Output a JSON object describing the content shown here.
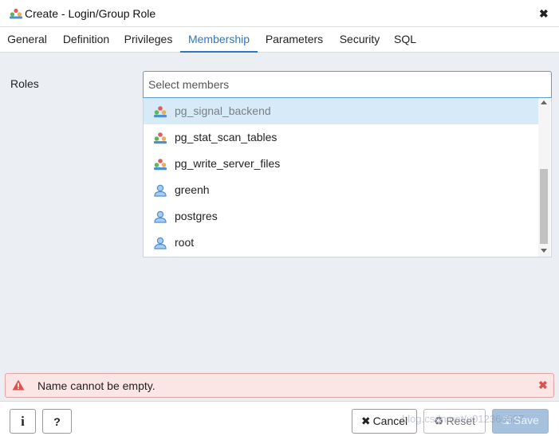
{
  "dialog": {
    "title": "Create - Login/Group Role"
  },
  "tabs": [
    {
      "label": "General"
    },
    {
      "label": "Definition"
    },
    {
      "label": "Privileges"
    },
    {
      "label": "Membership",
      "active": true
    },
    {
      "label": "Parameters"
    },
    {
      "label": "Security"
    },
    {
      "label": "SQL"
    }
  ],
  "roles": {
    "label": "Roles",
    "placeholder": "Select members",
    "options": [
      {
        "label": "pg_signal_backend",
        "icon": "group-role-icon",
        "highlighted": true
      },
      {
        "label": "pg_stat_scan_tables",
        "icon": "group-role-icon"
      },
      {
        "label": "pg_write_server_files",
        "icon": "group-role-icon"
      },
      {
        "label": "greenh",
        "icon": "user-role-icon"
      },
      {
        "label": "postgres",
        "icon": "user-role-icon"
      },
      {
        "label": "root",
        "icon": "user-role-icon"
      }
    ]
  },
  "error": {
    "message": "Name cannot be empty.",
    "color": "#d9534f"
  },
  "footer": {
    "info_label": "i",
    "help_label": "?",
    "cancel_label": "Cancel",
    "reset_label": "Reset",
    "save_label": "Save",
    "watermark": "blog.csdn.net/u012366527"
  },
  "colors": {
    "accent": "#2c76c5",
    "highlight": "#d6eaf8",
    "content_bg": "#ebeef3",
    "save_bg": "#a6c1de"
  }
}
